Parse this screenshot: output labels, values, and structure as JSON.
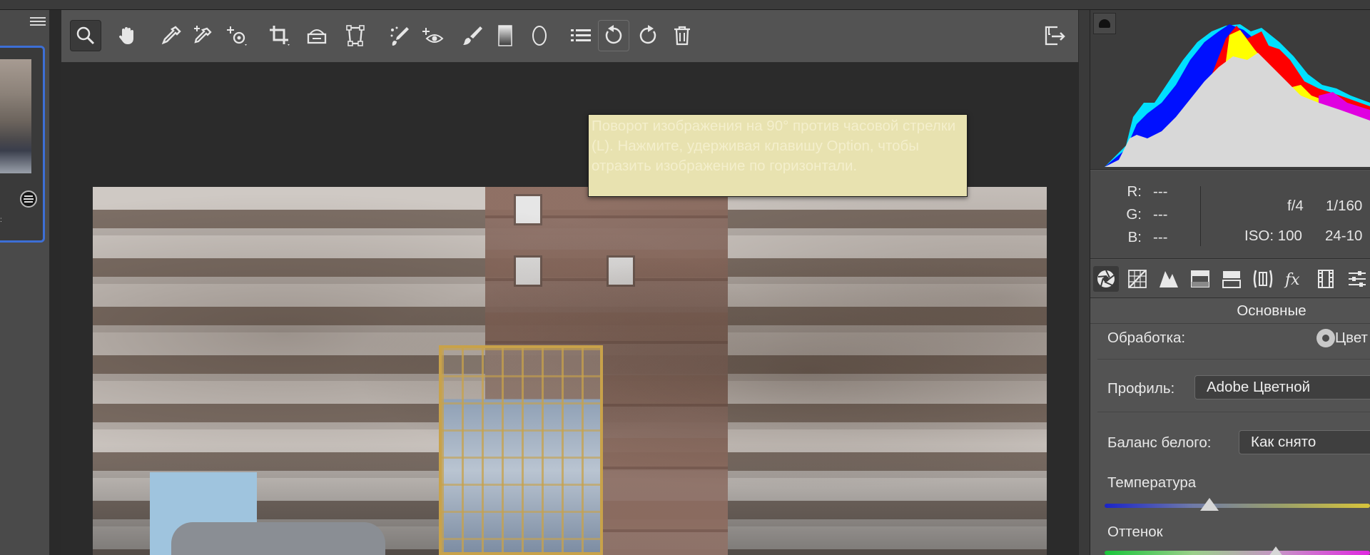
{
  "toolbar": {
    "tools": [
      {
        "name": "zoom-tool",
        "icon": "zoom-icon",
        "active": true
      },
      {
        "name": "hand-tool",
        "icon": "hand-icon"
      },
      {
        "name": "white-balance-tool",
        "icon": "eyedropper-icon"
      },
      {
        "name": "color-sampler-tool",
        "icon": "color-sampler-icon"
      },
      {
        "name": "targeted-adjustment-tool",
        "icon": "targeted-adjustment-icon"
      },
      {
        "name": "crop-tool",
        "icon": "crop-icon"
      },
      {
        "name": "straighten-tool",
        "icon": "straighten-icon"
      },
      {
        "name": "transform-tool",
        "icon": "transform-icon"
      },
      {
        "name": "spot-removal-tool",
        "icon": "spot-removal-icon"
      },
      {
        "name": "red-eye-tool",
        "icon": "red-eye-icon"
      },
      {
        "name": "adjustment-brush-tool",
        "icon": "brush-icon"
      },
      {
        "name": "graduated-filter-tool",
        "icon": "graduated-filter-icon"
      },
      {
        "name": "radial-filter-tool",
        "icon": "radial-filter-icon"
      },
      {
        "name": "preferences-tool",
        "icon": "list-icon"
      },
      {
        "name": "rotate-left-tool",
        "icon": "rotate-ccw-icon",
        "hover": true
      },
      {
        "name": "rotate-right-tool",
        "icon": "rotate-cw-icon"
      },
      {
        "name": "delete-tool",
        "icon": "trash-icon"
      }
    ],
    "export_icon": "export-icon"
  },
  "tooltip": {
    "text": "Поворот изображения на 90° против часовой стрелки (L). Нажмите, удерживая клавишу Option, чтобы отразить изображение по горизонтали."
  },
  "filmstrip": {
    "menu_icon": "menu-icon",
    "badge_icon": "adjustments-badge-icon",
    "label": ":"
  },
  "readout": {
    "r_label": "R:",
    "r_value": "---",
    "g_label": "G:",
    "g_value": "---",
    "b_label": "B:",
    "b_value": "---",
    "aperture": "f/4",
    "shutter": "1/160",
    "iso": "ISO: 100",
    "lens": "24-10"
  },
  "panel_tabs": [
    {
      "icon": "aperture-icon",
      "active": true
    },
    {
      "icon": "tone-curve-icon"
    },
    {
      "icon": "detail-icon"
    },
    {
      "icon": "hsl-icon"
    },
    {
      "icon": "split-toning-icon"
    },
    {
      "icon": "lens-corrections-icon"
    },
    {
      "icon": "fx-icon"
    },
    {
      "icon": "calibration-icon"
    },
    {
      "icon": "presets-icon"
    }
  ],
  "basic": {
    "title": "Основные",
    "treatment_label": "Обработка:",
    "treatment_value": "Цвет",
    "profile_label": "Профиль:",
    "profile_value": "Adobe Цветной",
    "wb_label": "Баланс белого:",
    "wb_value": "Как снято",
    "temperature_label": "Температура",
    "tint_label": "Оттенок"
  },
  "colors": {
    "accent": "#3d6fd6",
    "tooltip_bg": "#e8e2b0"
  }
}
